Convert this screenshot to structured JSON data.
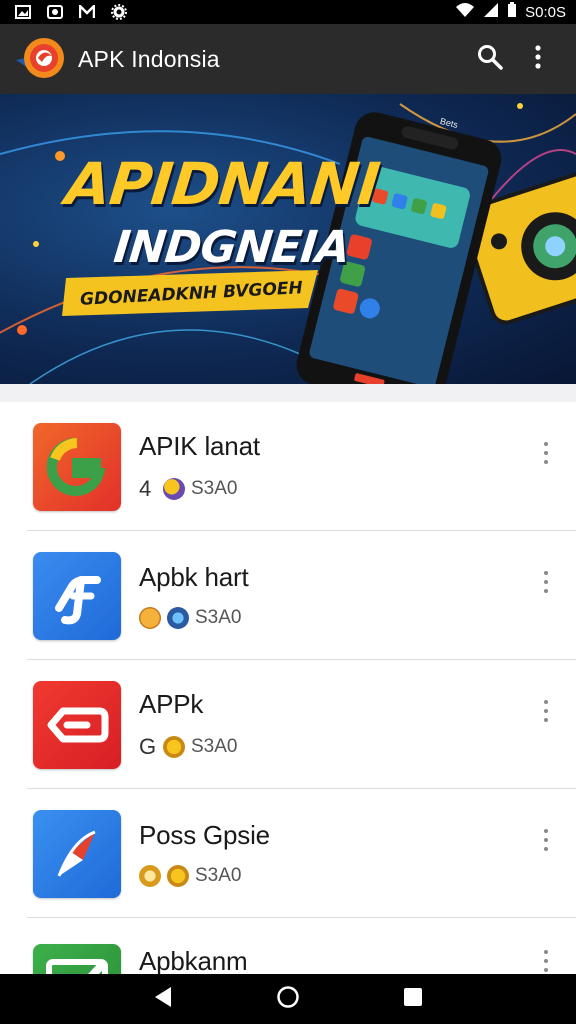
{
  "status_bar": {
    "time": "S0:0S",
    "left_icons": [
      "image-icon",
      "photo-icon",
      "m-icon",
      "gear-icon"
    ],
    "right_icons": [
      "wifi-icon",
      "signal-icon",
      "battery-icon"
    ]
  },
  "app_bar": {
    "title": "APK Indonsia",
    "logo_icon": "app-logo-icon",
    "actions": [
      "search-icon",
      "more-vert-icon"
    ]
  },
  "banner": {
    "title": "APIDNANI",
    "subtitle": "INDGNEIA",
    "ribbon": "GDONEADKNH BVGOEH",
    "phone_label": "Bets"
  },
  "apps": [
    {
      "name": "APIK lanat",
      "lead": "4",
      "size": "S3A0",
      "icon": "g-app-icon",
      "colors": [
        "#f04a2a",
        "#3ba048"
      ]
    },
    {
      "name": "Apbk hart",
      "lead": "",
      "size": "S3A0",
      "icon": "pf-app-icon",
      "colors": [
        "#2b7de9",
        "#ffffff"
      ]
    },
    {
      "name": "APPk",
      "lead": "G",
      "size": "S3A0",
      "icon": "tag-app-icon",
      "colors": [
        "#e8262b",
        "#ffffff"
      ]
    },
    {
      "name": "Poss Gpsie",
      "lead": "",
      "size": "S3A0",
      "icon": "compass-app-icon",
      "colors": [
        "#2f80e8",
        "#ffffff"
      ]
    },
    {
      "name": "Apbkanm",
      "lead": "",
      "size": "",
      "icon": "check-app-icon",
      "colors": [
        "#2f9e3c",
        "#ffffff"
      ]
    }
  ],
  "nav_bar": [
    "back-icon",
    "home-icon",
    "recents-icon"
  ]
}
